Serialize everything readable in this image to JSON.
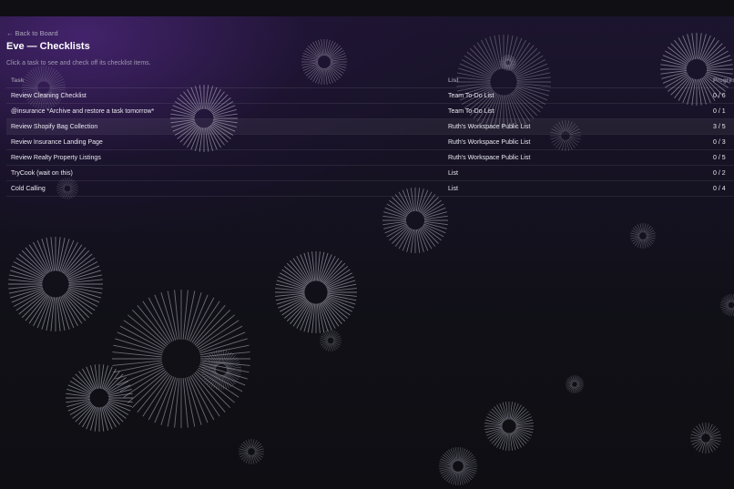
{
  "nav": {
    "back_arrow": "←",
    "back_label": "Back to Board"
  },
  "page": {
    "title": "Eve — Checklists",
    "subtitle": "Click a task to see and check off its checklist items."
  },
  "table": {
    "headers": {
      "task": "Task",
      "list": "List",
      "progress": "Progress"
    },
    "rows": [
      {
        "task": "Review Cleaning Checklist",
        "list": "Team To-Do List",
        "progress": "0 / 6"
      },
      {
        "task": "@insurance *Archive and restore a task tomorrow*",
        "list": "Team To-Do List",
        "progress": "0 / 1"
      },
      {
        "task": "Review Shopify Bag Collection",
        "list": "Ruth's Workspace Public List",
        "progress": "3 / 5"
      },
      {
        "task": "Review Insurance Landing Page",
        "list": "Ruth's Workspace Public List",
        "progress": "0 / 3"
      },
      {
        "task": "Review Realty Property Listings",
        "list": "Ruth's Workspace Public List",
        "progress": "0 / 5"
      },
      {
        "task": "TryCook (wait on this)",
        "list": "List",
        "progress": "0 / 2"
      },
      {
        "task": "Cold Calling",
        "list": "List",
        "progress": "0 / 4"
      }
    ],
    "selected_row_index": 2
  },
  "colors": {
    "background": "#101016",
    "accent_glow": "#582a8c",
    "text_primary": "#ffffff",
    "text_muted": "#9c99ad"
  }
}
